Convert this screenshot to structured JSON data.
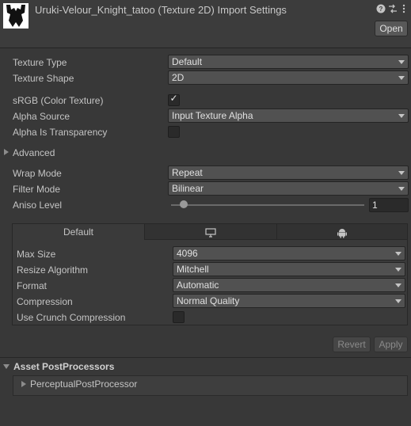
{
  "header": {
    "title": "Uruki-Velour_Knight_tatoo (Texture 2D) Import Settings",
    "open_label": "Open",
    "icons": [
      "help-icon",
      "presets-icon",
      "more-menu-icon"
    ]
  },
  "settings": {
    "texture_type": {
      "label": "Texture Type",
      "value": "Default"
    },
    "texture_shape": {
      "label": "Texture Shape",
      "value": "2D"
    },
    "srgb": {
      "label": "sRGB (Color Texture)",
      "checked": true
    },
    "alpha_source": {
      "label": "Alpha Source",
      "value": "Input Texture Alpha"
    },
    "alpha_transparency": {
      "label": "Alpha Is Transparency",
      "checked": false
    },
    "advanced": {
      "label": "Advanced"
    },
    "wrap_mode": {
      "label": "Wrap Mode",
      "value": "Repeat"
    },
    "filter_mode": {
      "label": "Filter Mode",
      "value": "Bilinear"
    },
    "aniso_level": {
      "label": "Aniso Level",
      "value": "1"
    }
  },
  "platform": {
    "tabs": [
      "Default",
      "monitor-icon",
      "android-icon"
    ],
    "default_tab_label": "Default",
    "max_size": {
      "label": "Max Size",
      "value": "4096"
    },
    "resize_algorithm": {
      "label": "Resize Algorithm",
      "value": "Mitchell"
    },
    "format": {
      "label": "Format",
      "value": "Automatic"
    },
    "compression": {
      "label": "Compression",
      "value": "Normal Quality"
    },
    "crunch": {
      "label": "Use Crunch Compression",
      "checked": false
    }
  },
  "actions": {
    "revert": "Revert",
    "apply": "Apply"
  },
  "postprocessors": {
    "header": "Asset PostProcessors",
    "items": [
      "PerceptualPostProcessor"
    ]
  }
}
